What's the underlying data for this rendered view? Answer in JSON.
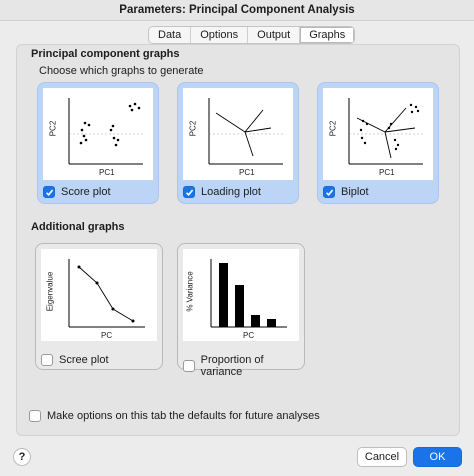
{
  "window": {
    "title": "Parameters: Principal Component Analysis"
  },
  "tabs": [
    {
      "label": "Data",
      "active": false
    },
    {
      "label": "Options",
      "active": false
    },
    {
      "label": "Output",
      "active": false
    },
    {
      "label": "Graphs",
      "active": true
    }
  ],
  "pca_graphs": {
    "title": "Principal component graphs",
    "subtitle": "Choose which graphs to generate",
    "cards": [
      {
        "label": "Score plot",
        "checked": true,
        "xlabel": "PC1",
        "ylabel": "PC2"
      },
      {
        "label": "Loading plot",
        "checked": true,
        "xlabel": "PC1",
        "ylabel": "PC2"
      },
      {
        "label": "Biplot",
        "checked": true,
        "xlabel": "PC1",
        "ylabel": "PC2"
      }
    ]
  },
  "additional_graphs": {
    "title": "Additional graphs",
    "cards": [
      {
        "label": "Scree plot",
        "checked": false,
        "xlabel": "PC",
        "ylabel": "Eigenvalue"
      },
      {
        "label": "Proportion of variance",
        "checked": false,
        "xlabel": "PC",
        "ylabel": "% Variance"
      }
    ]
  },
  "defaults_option": {
    "label": "Make options on this tab the defaults for future analyses",
    "checked": false
  },
  "footer": {
    "help_label": "?",
    "cancel_label": "Cancel",
    "ok_label": "OK"
  },
  "colors": {
    "accent": "#1a73e8",
    "selected_card": "#bcd5f6"
  }
}
